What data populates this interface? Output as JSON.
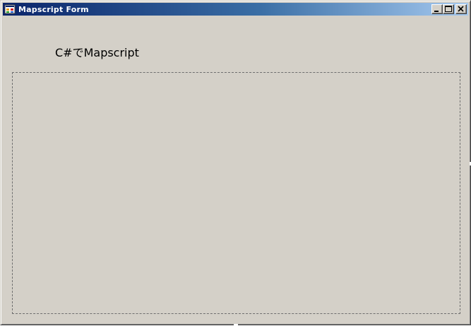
{
  "window": {
    "title": "Mapscript Form"
  },
  "icons": {
    "app": "app-icon",
    "minimize": "minimize-icon",
    "maximize": "maximize-icon",
    "close": "close-icon"
  },
  "form": {
    "label_text": "C#でMapscript"
  },
  "colors": {
    "titlebar_start": "#0a246a",
    "titlebar_end": "#a6caf0",
    "face": "#d4d0c8"
  }
}
